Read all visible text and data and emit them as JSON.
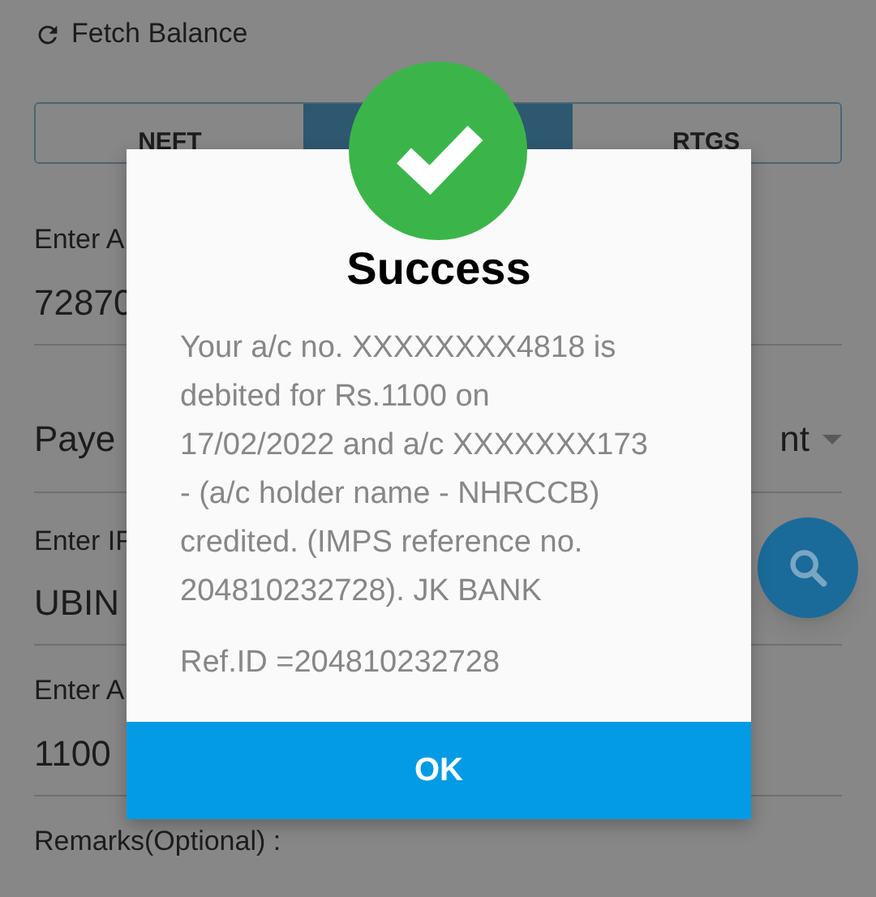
{
  "fetch_balance": {
    "label": "Fetch Balance"
  },
  "transfer_tabs": [
    {
      "label": "NEFT",
      "selected": false
    },
    {
      "selected": true
    },
    {
      "label": "RTGS",
      "selected": false
    }
  ],
  "fields": [
    {
      "kind": "text",
      "label": "Enter A",
      "value": "72870"
    },
    {
      "kind": "dropdown",
      "value": "Paye",
      "value_end": "nt"
    },
    {
      "kind": "search",
      "label": "Enter IF",
      "value": "UBIN"
    },
    {
      "kind": "text",
      "label": "Enter A",
      "value": "1100"
    },
    {
      "kind": "label",
      "label": "Remarks(Optional) :"
    }
  ],
  "dialog": {
    "title": "Success",
    "message_lines": [
      "Your a/c no. XXXXXXXX4818 is",
      "debited for Rs.1100 on",
      "17/02/2022 and a/c XXXXXXX173",
      "- (a/c holder name - NHRCCB)",
      "credited. (IMPS reference no.",
      "204810232728). JK BANK"
    ],
    "ref_id": "Ref.ID =204810232728",
    "button": "OK"
  }
}
